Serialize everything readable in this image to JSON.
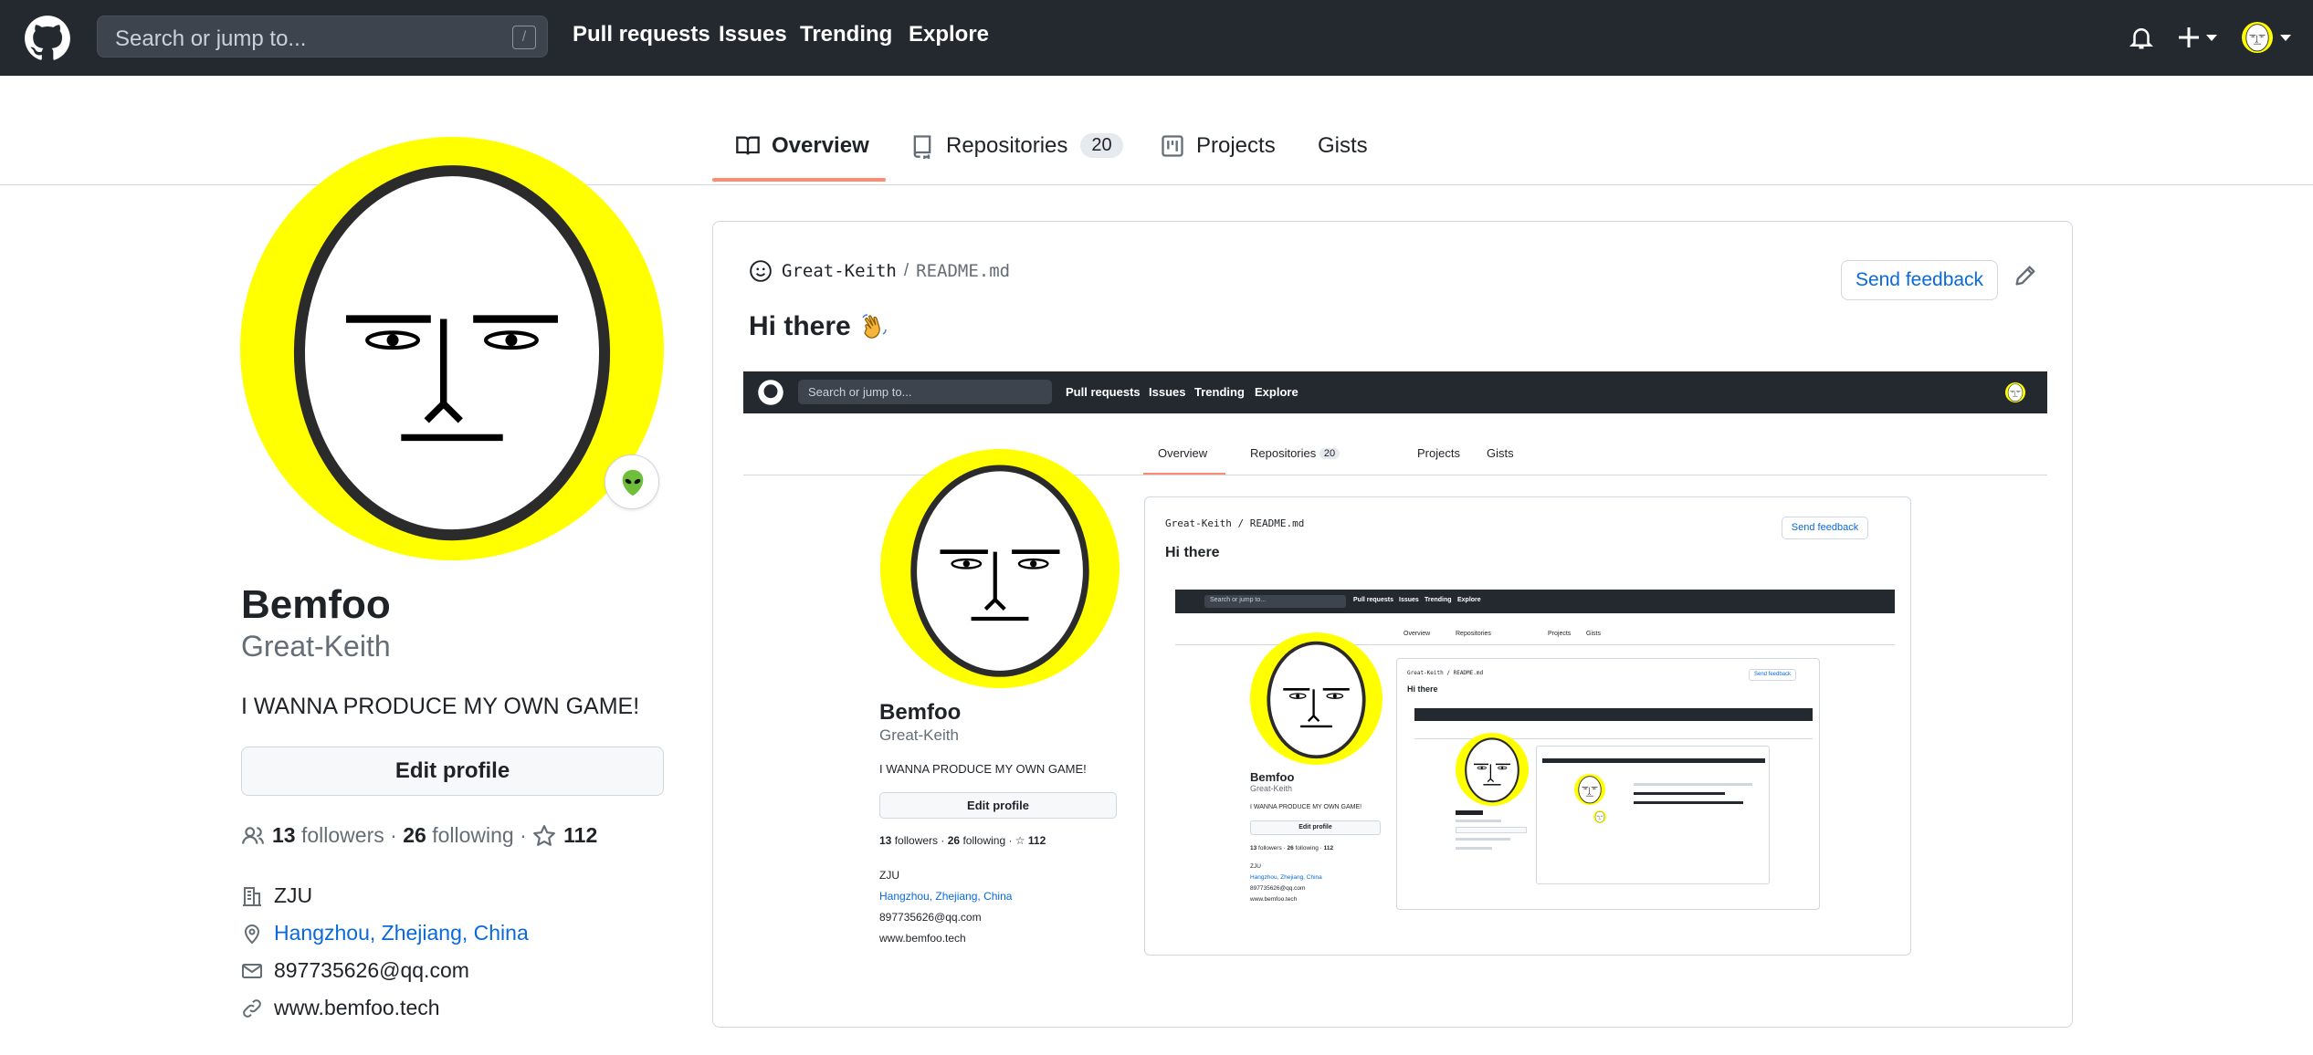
{
  "header": {
    "search_placeholder": "Search or jump to...",
    "search_shortcut": "/",
    "nav": [
      "Pull requests",
      "Issues",
      "Trending",
      "Explore"
    ],
    "icons": [
      "github-logo",
      "bell-icon",
      "plus-icon",
      "avatar"
    ]
  },
  "tabs": [
    {
      "label": "Overview",
      "icon": "book-icon",
      "active": true
    },
    {
      "label": "Repositories",
      "icon": "repo-icon",
      "count": "20"
    },
    {
      "label": "Projects",
      "icon": "project-icon"
    },
    {
      "label": "Gists"
    }
  ],
  "profile": {
    "name": "Bemfoo",
    "login": "Great-Keith",
    "bio": "I WANNA PRODUCE MY OWN GAME!",
    "edit_label": "Edit profile",
    "followers": "13",
    "followers_label": "followers",
    "following": "26",
    "following_label": "following",
    "stars": "112",
    "separator": "·",
    "company": "ZJU",
    "location": "Hangzhou, Zhejiang, China",
    "email": "897735626@qq.com",
    "website": "www.bemfoo.tech",
    "status_icon": "alien-icon"
  },
  "readme": {
    "owner": "Great-Keith",
    "path_sep": "/",
    "file": "README.md",
    "feedback_label": "Send feedback",
    "heading": "Hi there",
    "heading_emoji": "waving-hand-icon"
  },
  "colors": {
    "header_bg": "#24292f",
    "accent_underline": "#fd8c73",
    "link": "#0969da",
    "avatar_yellow": "#ffff00"
  }
}
